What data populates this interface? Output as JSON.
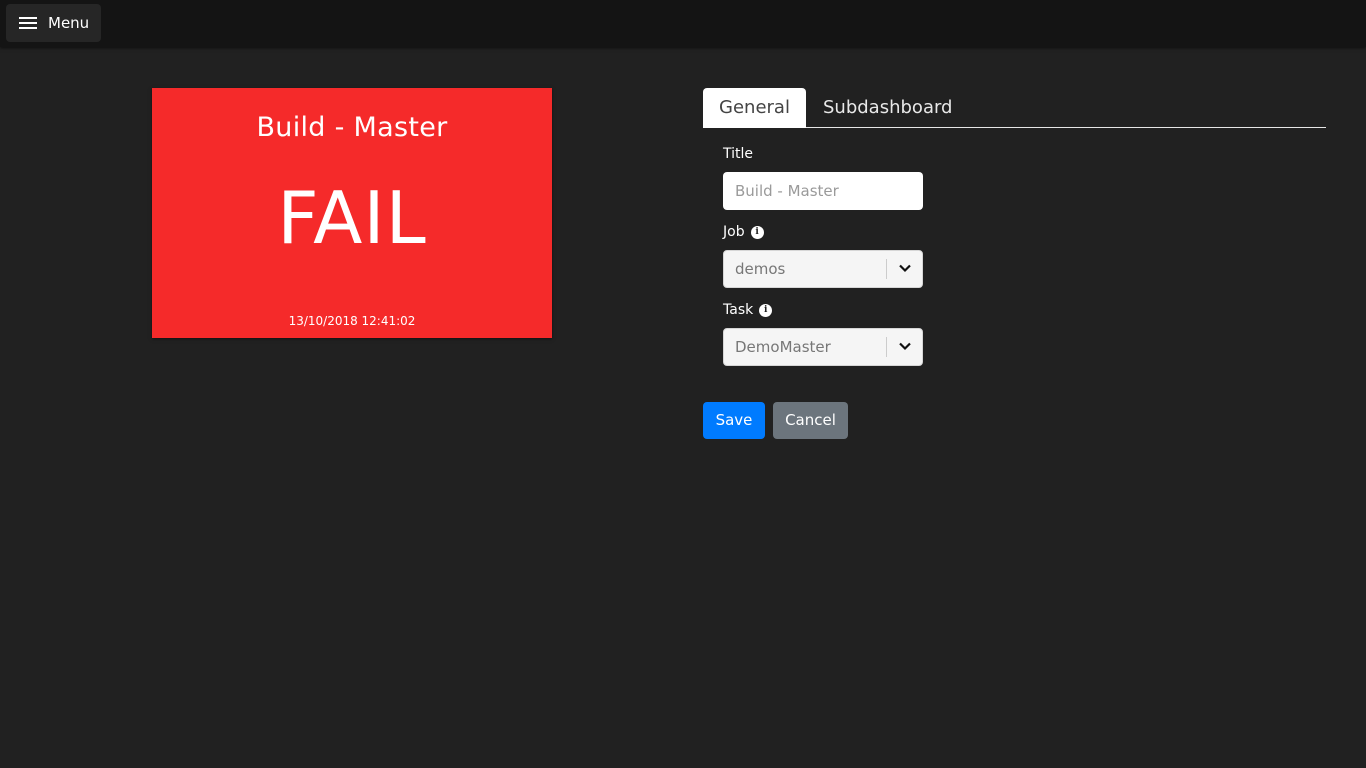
{
  "topbar": {
    "menu_label": "Menu"
  },
  "tile": {
    "title": "Build - Master",
    "status": "FAIL",
    "timestamp": "13/10/2018 12:41:02",
    "color": "#f52a2a"
  },
  "tabs": [
    {
      "label": "General",
      "active": true
    },
    {
      "label": "Subdashboard",
      "active": false
    }
  ],
  "form": {
    "title_label": "Title",
    "title_placeholder": "Build - Master",
    "job_label": "Job",
    "job_value": "demos",
    "task_label": "Task",
    "task_value": "DemoMaster"
  },
  "buttons": {
    "save_label": "Save",
    "cancel_label": "Cancel"
  },
  "colors": {
    "background": "#212121",
    "topbar": "#141414",
    "save": "#007bff",
    "cancel": "#6c757d"
  }
}
